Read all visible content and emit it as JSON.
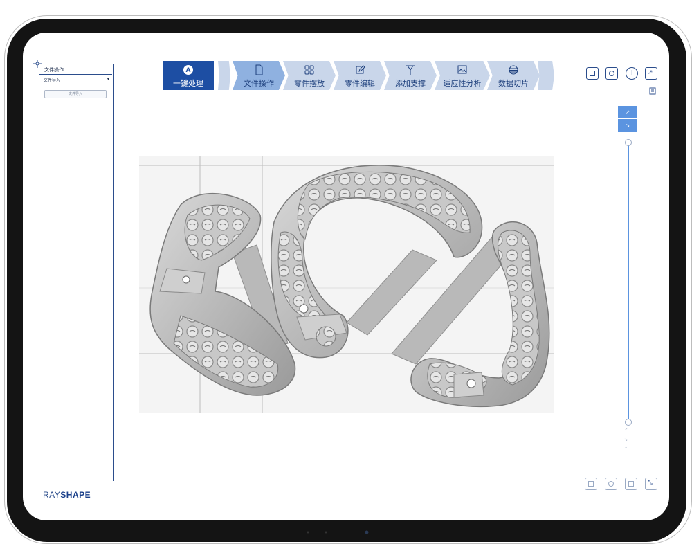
{
  "left_panel": {
    "title": "文件操作",
    "select_value": "文件导入",
    "button_label": "文件导入"
  },
  "brand": {
    "part1": "RAY",
    "part2": "SHAPE"
  },
  "toolbar": {
    "one_click": "一键处理",
    "one_click_icon_letter": "A",
    "steps": [
      {
        "label": "文件操作",
        "icon": "file-add-icon"
      },
      {
        "label": "零件摆放",
        "icon": "grid-icon"
      },
      {
        "label": "零件编辑",
        "icon": "edit-icon"
      },
      {
        "label": "添加支撑",
        "icon": "support-icon"
      },
      {
        "label": "适应性分析",
        "icon": "image-analysis-icon"
      },
      {
        "label": "数据切片",
        "icon": "layers-icon"
      }
    ]
  },
  "view_controls": {
    "zoom_in": "↗",
    "zoom_out": "↘"
  },
  "colors": {
    "accent": "#1d4ea3",
    "step_active": "#8fb1e0",
    "step_inactive": "#c9d6ea",
    "outline": "#2b4d8c"
  }
}
